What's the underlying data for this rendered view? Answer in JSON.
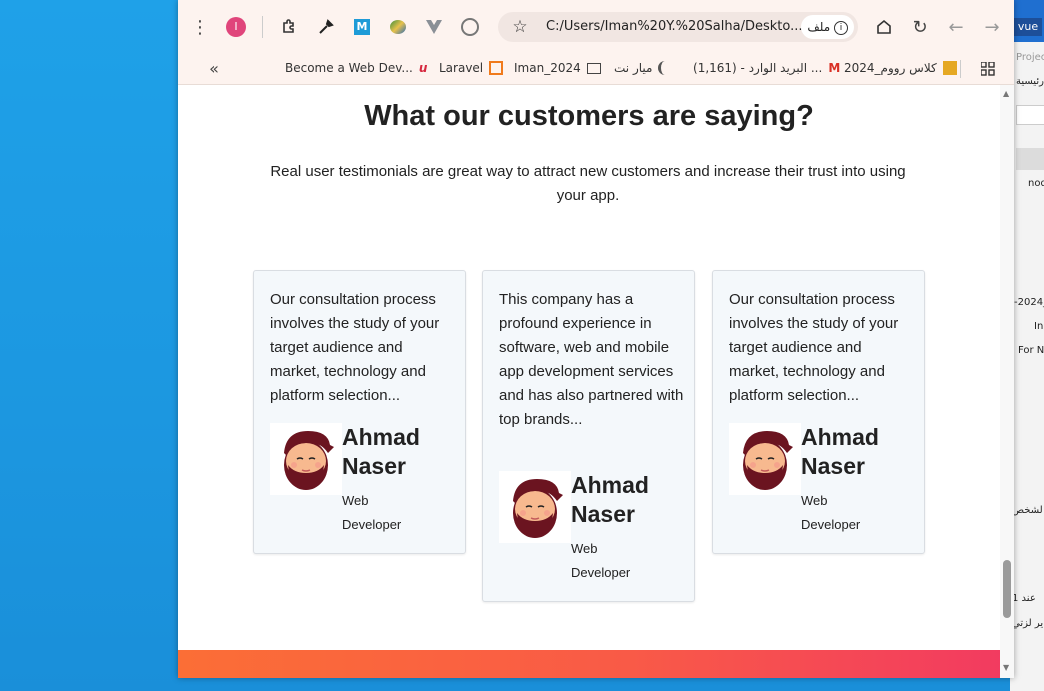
{
  "browser": {
    "profile_initial": "I",
    "url": "C:/Users/Iman%20Y.%20Salha/Deskto...",
    "url_chip": "ملف",
    "bookmarks": [
      "Become a Web Dev...",
      "Laravel",
      "Iman_2024",
      "ميار نت",
      "البريد الوارد - (1,161) ...",
      "كلاس رووم_2024"
    ]
  },
  "background_window": {
    "title": "vue",
    "fragments": [
      "Projec",
      "رئيسية",
      "nod",
      "-2024_",
      "In",
      "For N",
      "لشخص",
      "1 عند",
      "ير لزتي"
    ]
  },
  "page": {
    "title": "What our customers are saying?",
    "subtitle": "Real user testimonials are great way to attract new customers and increase their trust into using your app.",
    "testimonials": [
      {
        "text": "Our consultation process involves the study of your target audience and market, technology and platform selection...",
        "name": "Ahmad Naser",
        "role": "Web Developer"
      },
      {
        "text": "This company has a profound experience in software, web and mobile app development services and has also partnered with top brands...",
        "name": "Ahmad Naser",
        "role": "Web Developer"
      },
      {
        "text": "Our consultation process involves the study of your target audience and market, technology and platform selection...",
        "name": "Ahmad Naser",
        "role": "Web Developer"
      }
    ]
  },
  "colors": {
    "footer_gradient_start": "#fb6e36",
    "footer_gradient_end": "#f23b60",
    "avatar_hair": "#6b1420",
    "avatar_skin": "#f7b98f"
  }
}
